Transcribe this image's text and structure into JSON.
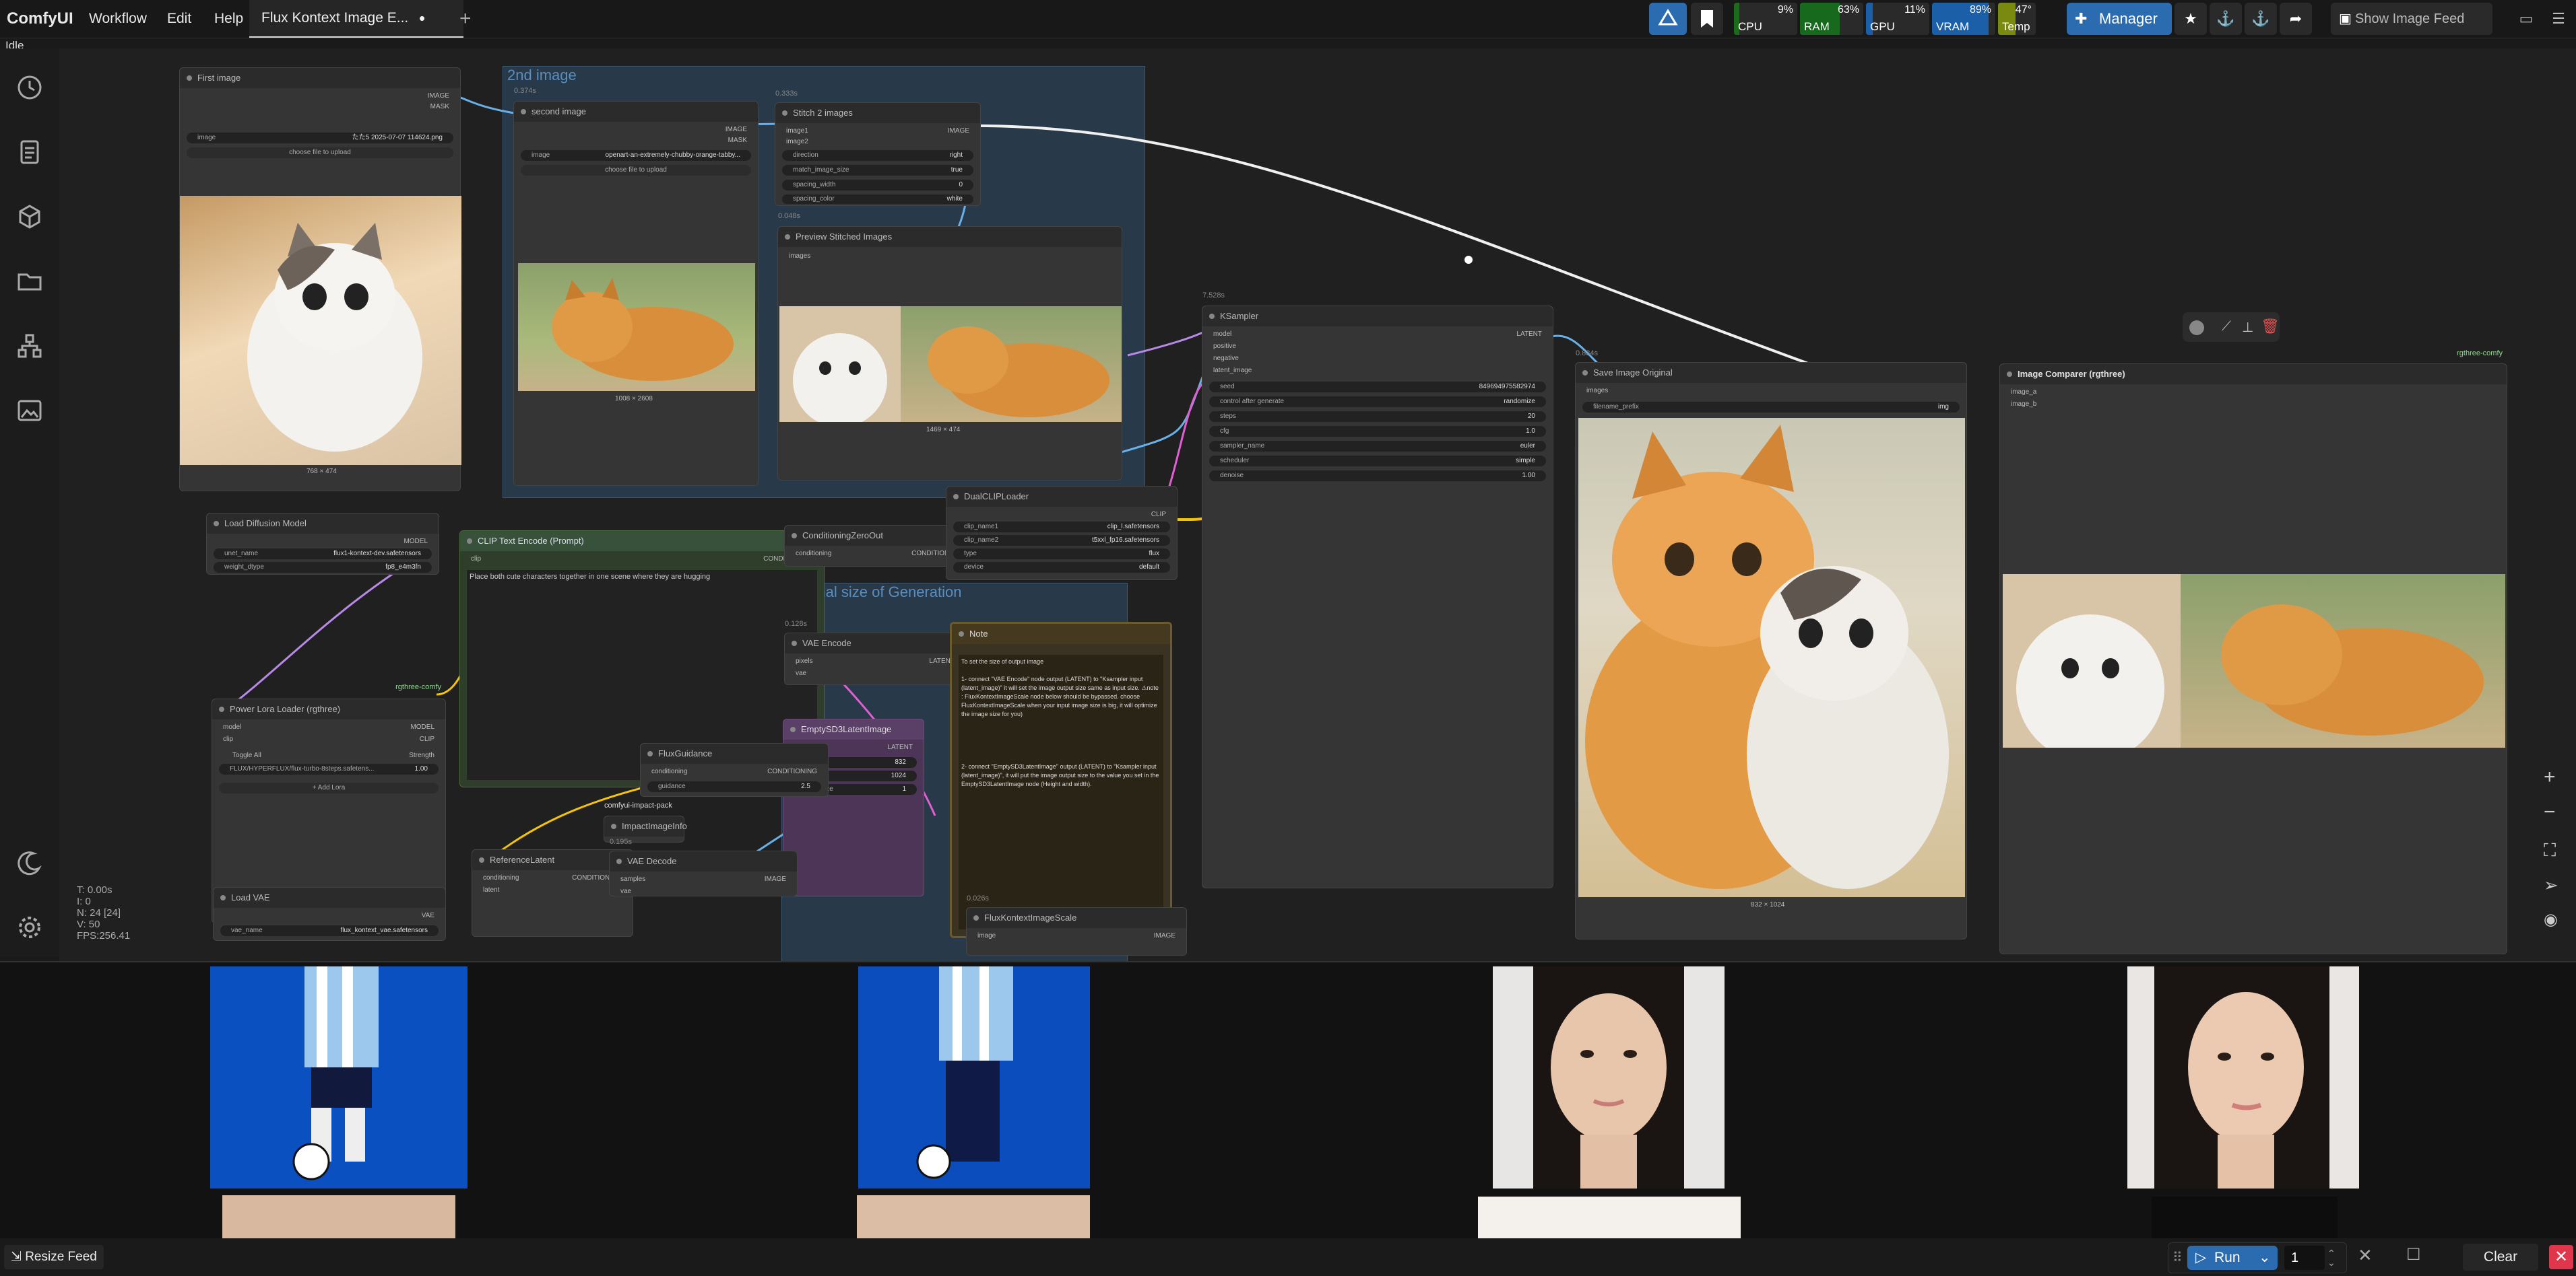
{
  "menu": {
    "logo": "ComfyUI",
    "items": [
      "Workflow",
      "Edit",
      "Help"
    ],
    "active_tab": "Flux Kontext Image E...",
    "tab_modified_marker": "•",
    "new_tab": "+"
  },
  "monitors": {
    "cpu": {
      "label": "CPU",
      "pct": "9%",
      "value": 9
    },
    "ram": {
      "label": "RAM",
      "pct": "63%",
      "value": 63
    },
    "gpu": {
      "label": "GPU",
      "pct": "11%",
      "value": 11
    },
    "vram": {
      "label": "VRAM",
      "pct": "89%",
      "value": 89
    },
    "temp": {
      "label": "Temp",
      "pct": "47°",
      "value": 47
    }
  },
  "toolbar": {
    "manager_label": "Manager",
    "show_feed_label": "Show Image Feed"
  },
  "status": {
    "idle": "Idle",
    "stats": [
      "T: 0.00s",
      "I: 0",
      "N: 24 [24]",
      "V: 50",
      "FPS:256.41"
    ]
  },
  "nodes": {
    "first_image": {
      "title": "First image",
      "image_label": "image",
      "image_value": "たた5 2025-07-07 114624.png",
      "upload": "choose file to upload",
      "size": "768 × 474",
      "out1": "IMAGE",
      "out2": "MASK"
    },
    "second_image": {
      "title": "second image",
      "timing": "0.374s",
      "image_label": "image",
      "image_value": "openart-an-extremely-chubby-orange-tabby...",
      "upload": "choose file to upload",
      "size": "1008 × 2608",
      "out1": "IMAGE",
      "out2": "MASK"
    },
    "stitch": {
      "title": "Stitch 2 images",
      "timing": "0.333s",
      "in1": "image1",
      "in2": "image2",
      "out": "IMAGE",
      "widgets": [
        [
          "direction",
          "right"
        ],
        [
          "match_image_size",
          "true"
        ],
        [
          "spacing_width",
          "0"
        ],
        [
          "spacing_color",
          "white"
        ]
      ]
    },
    "preview": {
      "title": "Preview Stitched Images",
      "timing": "0.048s",
      "in": "images",
      "size": "1469 × 474"
    },
    "group_2nd": {
      "title": "2nd image"
    },
    "group_orig": {
      "title": "Original size of Generation"
    },
    "ksampler": {
      "title": "KSampler",
      "timing": "7.528s",
      "inputs": [
        "model",
        "positive",
        "negative",
        "latent_image"
      ],
      "out": "LATENT",
      "widgets": [
        [
          "seed",
          "849694975582974"
        ],
        [
          "control after generate",
          "randomize"
        ],
        [
          "steps",
          "20"
        ],
        [
          "cfg",
          "1.0"
        ],
        [
          "sampler_name",
          "euler"
        ],
        [
          "scheduler",
          "simple"
        ],
        [
          "denoise",
          "1.00"
        ]
      ]
    },
    "save_image": {
      "title": "Save Image Original",
      "timing": "0.834s",
      "in": "images",
      "prefix_label": "filename_prefix",
      "prefix_value": "img",
      "size": "832 × 1024"
    },
    "comparer": {
      "title": "Image Comparer (rgthree)",
      "badge": "rgthree-comfy",
      "in1": "image_a",
      "in2": "image_b"
    },
    "load_diffusion": {
      "title": "Load Diffusion Model",
      "out": "MODEL",
      "widgets": [
        [
          "unet_name",
          "flux1-kontext-dev.safetensors"
        ],
        [
          "weight_dtype",
          "fp8_e4m3fn"
        ]
      ]
    },
    "clip_encode": {
      "title": "CLIP Text Encode (Prompt)",
      "in": "clip",
      "out": "CONDITIONING",
      "text": "Place both cute characters together in one scene where they are hugging"
    },
    "cond_zero": {
      "title": "ConditioningZeroOut",
      "in": "conditioning",
      "out": "CONDITIONING"
    },
    "dual_clip": {
      "title": "DualCLIPLoader",
      "out": "CLIP",
      "widgets": [
        [
          "clip_name1",
          "clip_l.safetensors"
        ],
        [
          "clip_name2",
          "t5xxl_fp16.safetensors"
        ],
        [
          "type",
          "flux"
        ],
        [
          "device",
          "default"
        ]
      ]
    },
    "vae_encode": {
      "title": "VAE Encode",
      "timing": "0.128s",
      "in1": "pixels",
      "in2": "vae",
      "out": "LATENT"
    },
    "note": {
      "title": "Note",
      "text1": "To set the size of output image",
      "text2": "1- connect \"VAE Encode\" node output (LATENT) to \"Ksampler input (latent_image)\" it will set the image output size same as input size. ⚠note : FluxKontextImageScale node below should be bypassed. choose FluxKontextImageScale when your input image size is big, it will optimize the image size for you)",
      "text3": "2- connect \"EmptySD3LatentImage\" output (LATENT) to \"Ksampler input (latent_image)\", it will put the image output size to the value you set in the EmptySD3LatentImage node (Height and width)."
    },
    "empty_latent": {
      "title": "EmptySD3LatentImage",
      "out": "LATENT",
      "widgets": [
        [
          "width",
          "832"
        ],
        [
          "height",
          "1024"
        ],
        [
          "batch_size",
          "1"
        ]
      ]
    },
    "power_lora": {
      "title": "Power Lora Loader (rgthree)",
      "badge": "rgthree-comfy",
      "in1": "model",
      "in2": "clip",
      "out1": "MODEL",
      "out2": "CLIP",
      "toggle": "Toggle All",
      "strength": "Strength",
      "lora_name": "FLUX/HYPERFLUX/flux-turbo-8steps.safetens...",
      "lora_value": "1.00",
      "add": "+ Add Lora"
    },
    "flux_guidance": {
      "title": "FluxGuidance",
      "in": "conditioning",
      "out": "CONDITIONING",
      "guidance_label": "guidance",
      "guidance_value": "2.5"
    },
    "impact_info": {
      "title": "ImpactImageInfo",
      "badge": "comfyui-impact-pack"
    },
    "reference_latent": {
      "title": "ReferenceLatent",
      "timing": "0.195s",
      "in1": "conditioning",
      "in2": "latent",
      "out": "CONDITIONING"
    },
    "vae_decode": {
      "title": "VAE Decode",
      "in1": "samples",
      "in2": "vae",
      "out": "IMAGE"
    },
    "load_vae": {
      "title": "Load VAE",
      "out": "VAE",
      "vae_label": "vae_name",
      "vae_value": "flux_kontext_vae.safetensors"
    },
    "kontext_scale": {
      "title": "FluxKontextImageScale",
      "timing": "0.026s",
      "in": "image",
      "out": "IMAGE"
    }
  },
  "bottom": {
    "resize_feed": "Resize Feed",
    "run": "Run",
    "batch_count": "1",
    "clear": "Clear"
  },
  "colors": {
    "accent_blue": "#2b6cb0",
    "group_blue": "#28394a",
    "link_yellow": "#f5c400",
    "link_purple": "#b889e8",
    "link_blue": "#6ab0e8",
    "link_pink": "#e25fd2"
  }
}
